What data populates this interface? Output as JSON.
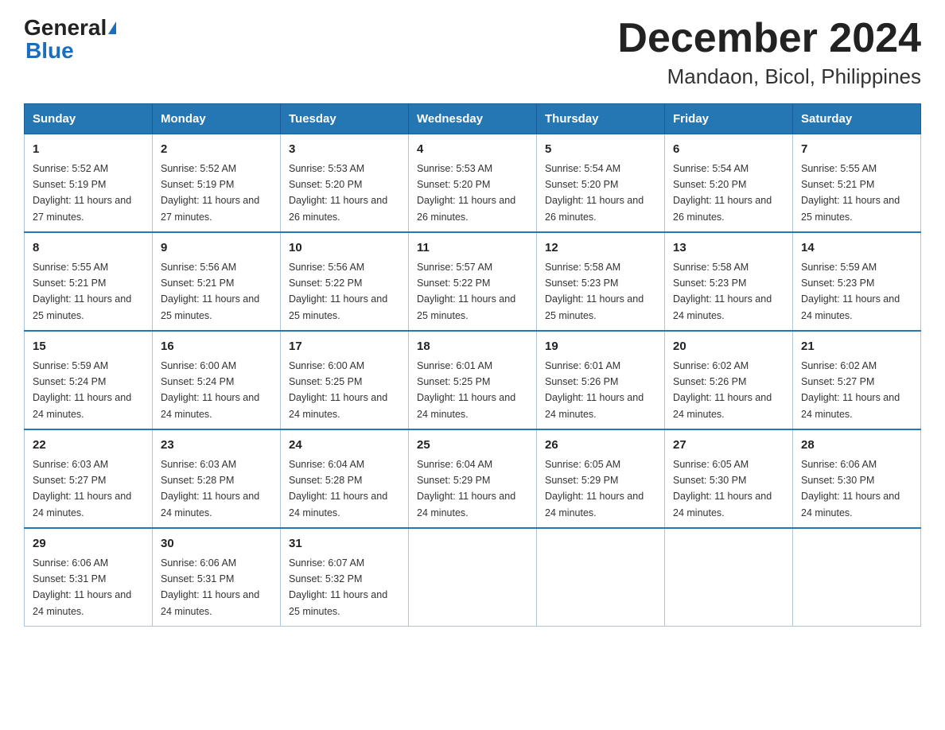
{
  "logo": {
    "text_black": "General",
    "text_blue": "Blue"
  },
  "title": "December 2024",
  "subtitle": "Mandaon, Bicol, Philippines",
  "days_of_week": [
    "Sunday",
    "Monday",
    "Tuesday",
    "Wednesday",
    "Thursday",
    "Friday",
    "Saturday"
  ],
  "weeks": [
    [
      {
        "day": "1",
        "sunrise": "5:52 AM",
        "sunset": "5:19 PM",
        "daylight": "11 hours and 27 minutes."
      },
      {
        "day": "2",
        "sunrise": "5:52 AM",
        "sunset": "5:19 PM",
        "daylight": "11 hours and 27 minutes."
      },
      {
        "day": "3",
        "sunrise": "5:53 AM",
        "sunset": "5:20 PM",
        "daylight": "11 hours and 26 minutes."
      },
      {
        "day": "4",
        "sunrise": "5:53 AM",
        "sunset": "5:20 PM",
        "daylight": "11 hours and 26 minutes."
      },
      {
        "day": "5",
        "sunrise": "5:54 AM",
        "sunset": "5:20 PM",
        "daylight": "11 hours and 26 minutes."
      },
      {
        "day": "6",
        "sunrise": "5:54 AM",
        "sunset": "5:20 PM",
        "daylight": "11 hours and 26 minutes."
      },
      {
        "day": "7",
        "sunrise": "5:55 AM",
        "sunset": "5:21 PM",
        "daylight": "11 hours and 25 minutes."
      }
    ],
    [
      {
        "day": "8",
        "sunrise": "5:55 AM",
        "sunset": "5:21 PM",
        "daylight": "11 hours and 25 minutes."
      },
      {
        "day": "9",
        "sunrise": "5:56 AM",
        "sunset": "5:21 PM",
        "daylight": "11 hours and 25 minutes."
      },
      {
        "day": "10",
        "sunrise": "5:56 AM",
        "sunset": "5:22 PM",
        "daylight": "11 hours and 25 minutes."
      },
      {
        "day": "11",
        "sunrise": "5:57 AM",
        "sunset": "5:22 PM",
        "daylight": "11 hours and 25 minutes."
      },
      {
        "day": "12",
        "sunrise": "5:58 AM",
        "sunset": "5:23 PM",
        "daylight": "11 hours and 25 minutes."
      },
      {
        "day": "13",
        "sunrise": "5:58 AM",
        "sunset": "5:23 PM",
        "daylight": "11 hours and 24 minutes."
      },
      {
        "day": "14",
        "sunrise": "5:59 AM",
        "sunset": "5:23 PM",
        "daylight": "11 hours and 24 minutes."
      }
    ],
    [
      {
        "day": "15",
        "sunrise": "5:59 AM",
        "sunset": "5:24 PM",
        "daylight": "11 hours and 24 minutes."
      },
      {
        "day": "16",
        "sunrise": "6:00 AM",
        "sunset": "5:24 PM",
        "daylight": "11 hours and 24 minutes."
      },
      {
        "day": "17",
        "sunrise": "6:00 AM",
        "sunset": "5:25 PM",
        "daylight": "11 hours and 24 minutes."
      },
      {
        "day": "18",
        "sunrise": "6:01 AM",
        "sunset": "5:25 PM",
        "daylight": "11 hours and 24 minutes."
      },
      {
        "day": "19",
        "sunrise": "6:01 AM",
        "sunset": "5:26 PM",
        "daylight": "11 hours and 24 minutes."
      },
      {
        "day": "20",
        "sunrise": "6:02 AM",
        "sunset": "5:26 PM",
        "daylight": "11 hours and 24 minutes."
      },
      {
        "day": "21",
        "sunrise": "6:02 AM",
        "sunset": "5:27 PM",
        "daylight": "11 hours and 24 minutes."
      }
    ],
    [
      {
        "day": "22",
        "sunrise": "6:03 AM",
        "sunset": "5:27 PM",
        "daylight": "11 hours and 24 minutes."
      },
      {
        "day": "23",
        "sunrise": "6:03 AM",
        "sunset": "5:28 PM",
        "daylight": "11 hours and 24 minutes."
      },
      {
        "day": "24",
        "sunrise": "6:04 AM",
        "sunset": "5:28 PM",
        "daylight": "11 hours and 24 minutes."
      },
      {
        "day": "25",
        "sunrise": "6:04 AM",
        "sunset": "5:29 PM",
        "daylight": "11 hours and 24 minutes."
      },
      {
        "day": "26",
        "sunrise": "6:05 AM",
        "sunset": "5:29 PM",
        "daylight": "11 hours and 24 minutes."
      },
      {
        "day": "27",
        "sunrise": "6:05 AM",
        "sunset": "5:30 PM",
        "daylight": "11 hours and 24 minutes."
      },
      {
        "day": "28",
        "sunrise": "6:06 AM",
        "sunset": "5:30 PM",
        "daylight": "11 hours and 24 minutes."
      }
    ],
    [
      {
        "day": "29",
        "sunrise": "6:06 AM",
        "sunset": "5:31 PM",
        "daylight": "11 hours and 24 minutes."
      },
      {
        "day": "30",
        "sunrise": "6:06 AM",
        "sunset": "5:31 PM",
        "daylight": "11 hours and 24 minutes."
      },
      {
        "day": "31",
        "sunrise": "6:07 AM",
        "sunset": "5:32 PM",
        "daylight": "11 hours and 25 minutes."
      },
      null,
      null,
      null,
      null
    ]
  ]
}
